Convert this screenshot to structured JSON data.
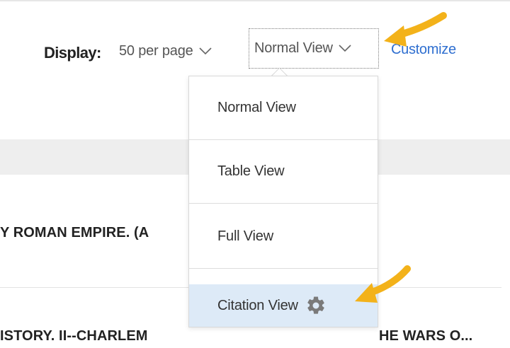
{
  "display": {
    "label": "Display:",
    "per_page": "50 per page",
    "view_selected": "Normal View",
    "customize": "Customize"
  },
  "menu": {
    "items": [
      {
        "label": "Normal View"
      },
      {
        "label": "Table View"
      },
      {
        "label": "Full View"
      },
      {
        "label": "Citation View"
      }
    ]
  },
  "results": {
    "title_1": "Y ROMAN EMPIRE. (A",
    "title_2": "ISTORY. II--CHARLEM",
    "title_2_tail": "HE WARS O..."
  },
  "colors": {
    "link": "#2f6fd0",
    "arrow": "#f3b21a",
    "active_item": "#ddeaf7",
    "band": "#eeeeee"
  },
  "icons": {
    "chevron": "chevron-down-icon",
    "gear": "gear-icon",
    "arrow": "arrow-annotation-icon"
  }
}
